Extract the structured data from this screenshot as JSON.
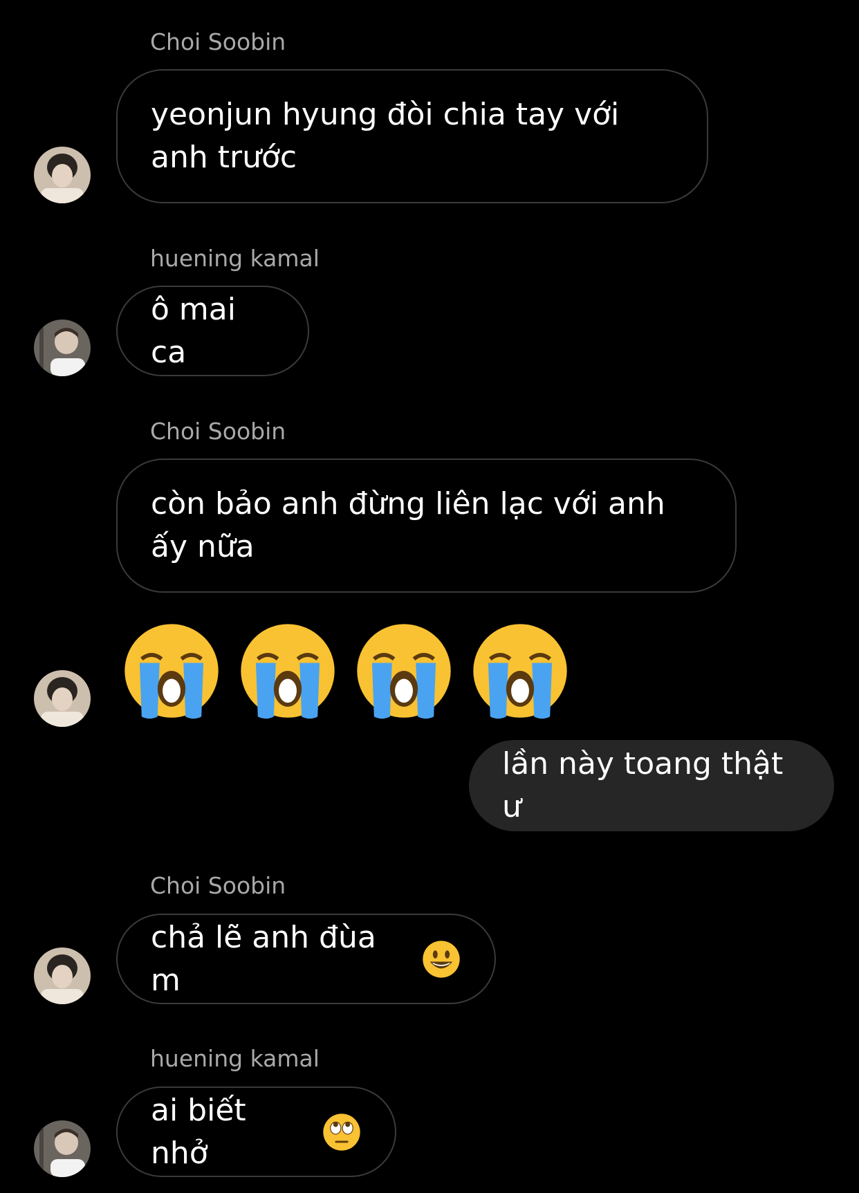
{
  "messages": [
    {
      "sender": "Choi Soobin",
      "text": "yeonjun hyung đòi chia tay với anh trước"
    },
    {
      "sender": "huening kamal",
      "text": "ô mai ca"
    },
    {
      "sender": "Choi Soobin",
      "text": "còn bảo anh đừng liên lạc với anh ấy nữa"
    },
    {
      "emojis": [
        "loudly-crying-face",
        "loudly-crying-face",
        "loudly-crying-face",
        "loudly-crying-face"
      ]
    },
    {
      "outgoing_text": "lần này toang thật ư"
    },
    {
      "sender": "Choi Soobin",
      "text": "chả lẽ anh đùa m",
      "emoji": "grinning-face"
    },
    {
      "sender": "huening kamal",
      "text": "ai biết nhở",
      "emoji": "face-with-rolling-eyes"
    }
  ],
  "colors": {
    "background": "#000000",
    "sender_name": "#a9a9a9",
    "bubble_border": "#3a3a3a",
    "outgoing_bubble": "#262626",
    "text": "#ffffff"
  }
}
